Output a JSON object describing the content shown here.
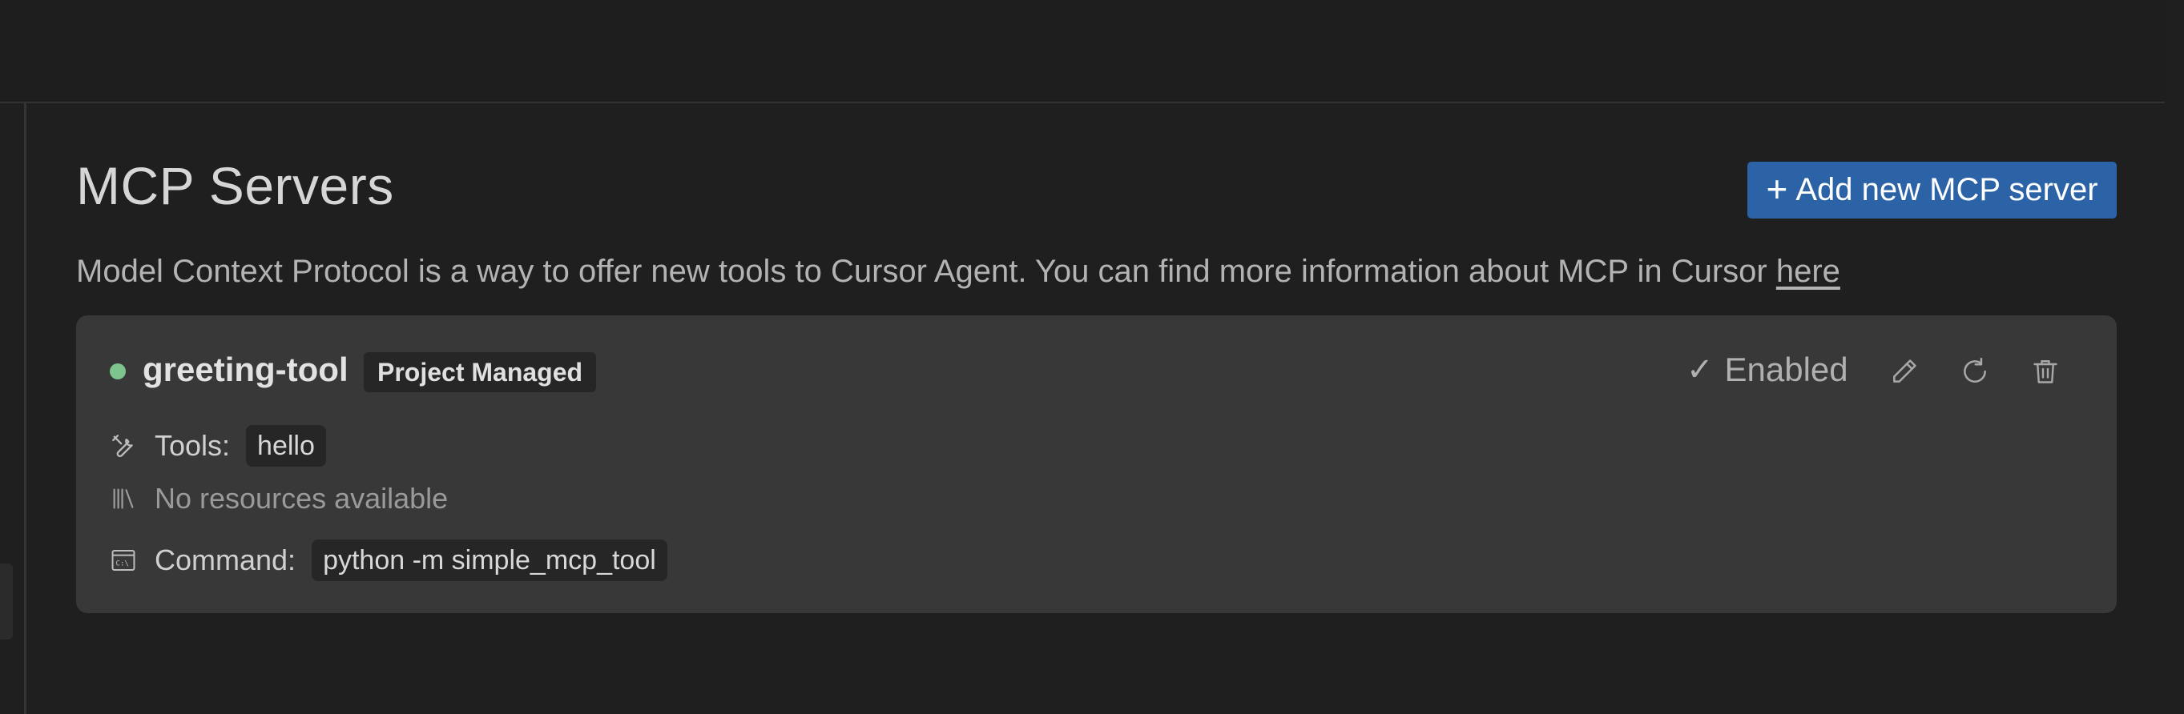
{
  "page": {
    "title": "MCP Servers",
    "add_button_label": "Add new MCP server",
    "description": "Model Context Protocol is a way to offer new tools to Cursor Agent. You can find more information about MCP in Cursor ",
    "description_link": "here"
  },
  "server": {
    "name": "greeting-tool",
    "badge": "Project Managed",
    "status_color": "#7dc48d",
    "enabled_label": "Enabled",
    "tools_label": "Tools:",
    "tools": [
      "hello"
    ],
    "resources_text": "No resources available",
    "command_label": "Command:",
    "command": "python -m simple_mcp_tool"
  },
  "colors": {
    "accent": "#2b63a6",
    "background": "#1f1f1f",
    "card": "#383838"
  }
}
